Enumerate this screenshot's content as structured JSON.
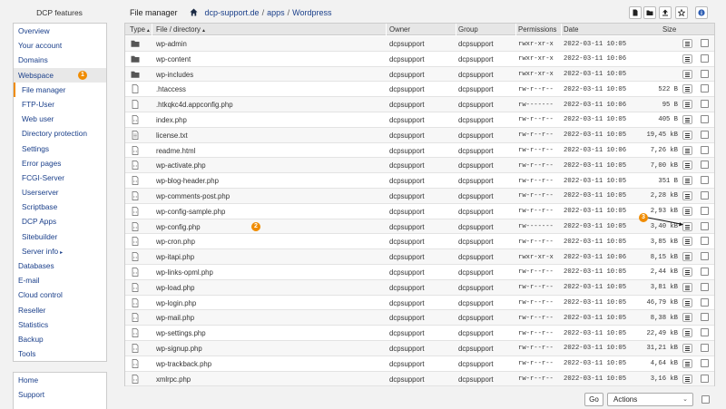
{
  "sidebar": {
    "title": "DCP features",
    "items": [
      {
        "label": "Overview",
        "level": 0
      },
      {
        "label": "Your account",
        "level": 0
      },
      {
        "label": "Domains",
        "level": 0
      },
      {
        "label": "Webspace",
        "level": 0,
        "active": true,
        "badge": "1"
      },
      {
        "label": "File manager",
        "level": 1,
        "current": true
      },
      {
        "label": "FTP-User",
        "level": 1
      },
      {
        "label": "Web user",
        "level": 1
      },
      {
        "label": "Directory protection",
        "level": 1
      },
      {
        "label": "Settings",
        "level": 1
      },
      {
        "label": "Error pages",
        "level": 1
      },
      {
        "label": "FCGI-Server",
        "level": 1
      },
      {
        "label": "Userserver",
        "level": 1
      },
      {
        "label": "Scriptbase",
        "level": 1
      },
      {
        "label": "DCP Apps",
        "level": 1
      },
      {
        "label": "Sitebuilder",
        "level": 1
      },
      {
        "label": "Server info",
        "level": 1,
        "arrow": "▸"
      },
      {
        "label": "Databases",
        "level": 0
      },
      {
        "label": "E-mail",
        "level": 0
      },
      {
        "label": "Cloud control",
        "level": 0
      },
      {
        "label": "Reseller",
        "level": 0
      },
      {
        "label": "Statistics",
        "level": 0
      },
      {
        "label": "Backup",
        "level": 0
      },
      {
        "label": "Tools",
        "level": 0
      }
    ],
    "bottom_items": [
      {
        "label": "Home"
      },
      {
        "label": "Support"
      }
    ]
  },
  "header": {
    "title": "File manager",
    "breadcrumb": [
      "dcp-support.de",
      "apps",
      "Wordpress"
    ],
    "breadcrumb_sep": "/",
    "tools": [
      "new-file-icon",
      "new-folder-icon",
      "upload-icon",
      "star-icon",
      "info-icon"
    ]
  },
  "table": {
    "columns": {
      "type": "Type",
      "name": "File / directory",
      "owner": "Owner",
      "group": "Group",
      "permissions": "Permissions",
      "date": "Date",
      "size": "Size"
    },
    "sort_arrow": "▲",
    "rows": [
      {
        "type": "folder",
        "name": "wp-admin",
        "owner": "dcpsupport",
        "group": "dcpsupport",
        "perm": "rwxr-xr-x",
        "date": "2022-03-11 10:05",
        "size": ""
      },
      {
        "type": "folder",
        "name": "wp-content",
        "owner": "dcpsupport",
        "group": "dcpsupport",
        "perm": "rwxr-xr-x",
        "date": "2022-03-11 10:06",
        "size": ""
      },
      {
        "type": "folder",
        "name": "wp-includes",
        "owner": "dcpsupport",
        "group": "dcpsupport",
        "perm": "rwxr-xr-x",
        "date": "2022-03-11 10:05",
        "size": ""
      },
      {
        "type": "file",
        "name": ".htaccess",
        "owner": "dcpsupport",
        "group": "dcpsupport",
        "perm": "rw-r--r--",
        "date": "2022-03-11 10:05",
        "size": "522 B"
      },
      {
        "type": "file",
        "name": ".htkqkc4d.appconfig.php",
        "owner": "dcpsupport",
        "group": "dcpsupport",
        "perm": "rw-------",
        "date": "2022-03-11 10:06",
        "size": "95 B"
      },
      {
        "type": "code",
        "name": "index.php",
        "owner": "dcpsupport",
        "group": "dcpsupport",
        "perm": "rw-r--r--",
        "date": "2022-03-11 10:05",
        "size": "405 B"
      },
      {
        "type": "text",
        "name": "license.txt",
        "owner": "dcpsupport",
        "group": "dcpsupport",
        "perm": "rw-r--r--",
        "date": "2022-03-11 10:05",
        "size": "19,45 kB"
      },
      {
        "type": "code",
        "name": "readme.html",
        "owner": "dcpsupport",
        "group": "dcpsupport",
        "perm": "rw-r--r--",
        "date": "2022-03-11 10:06",
        "size": "7,26 kB"
      },
      {
        "type": "code",
        "name": "wp-activate.php",
        "owner": "dcpsupport",
        "group": "dcpsupport",
        "perm": "rw-r--r--",
        "date": "2022-03-11 10:05",
        "size": "7,00 kB"
      },
      {
        "type": "code",
        "name": "wp-blog-header.php",
        "owner": "dcpsupport",
        "group": "dcpsupport",
        "perm": "rw-r--r--",
        "date": "2022-03-11 10:05",
        "size": "351 B"
      },
      {
        "type": "code",
        "name": "wp-comments-post.php",
        "owner": "dcpsupport",
        "group": "dcpsupport",
        "perm": "rw-r--r--",
        "date": "2022-03-11 10:05",
        "size": "2,28 kB"
      },
      {
        "type": "code",
        "name": "wp-config-sample.php",
        "owner": "dcpsupport",
        "group": "dcpsupport",
        "perm": "rw-r--r--",
        "date": "2022-03-11 10:05",
        "size": "2,93 kB"
      },
      {
        "type": "code",
        "name": "wp-config.php",
        "owner": "dcpsupport",
        "group": "dcpsupport",
        "perm": "rw-------",
        "date": "2022-03-11 10:05",
        "size": "3,40 kB",
        "badge": "2",
        "menu_badge": "3"
      },
      {
        "type": "code",
        "name": "wp-cron.php",
        "owner": "dcpsupport",
        "group": "dcpsupport",
        "perm": "rw-r--r--",
        "date": "2022-03-11 10:05",
        "size": "3,85 kB"
      },
      {
        "type": "code",
        "name": "wp-itapi.php",
        "owner": "dcpsupport",
        "group": "dcpsupport",
        "perm": "rwxr-xr-x",
        "date": "2022-03-11 10:06",
        "size": "8,15 kB"
      },
      {
        "type": "code",
        "name": "wp-links-opml.php",
        "owner": "dcpsupport",
        "group": "dcpsupport",
        "perm": "rw-r--r--",
        "date": "2022-03-11 10:05",
        "size": "2,44 kB"
      },
      {
        "type": "code",
        "name": "wp-load.php",
        "owner": "dcpsupport",
        "group": "dcpsupport",
        "perm": "rw-r--r--",
        "date": "2022-03-11 10:05",
        "size": "3,81 kB"
      },
      {
        "type": "code",
        "name": "wp-login.php",
        "owner": "dcpsupport",
        "group": "dcpsupport",
        "perm": "rw-r--r--",
        "date": "2022-03-11 10:05",
        "size": "46,79 kB"
      },
      {
        "type": "code",
        "name": "wp-mail.php",
        "owner": "dcpsupport",
        "group": "dcpsupport",
        "perm": "rw-r--r--",
        "date": "2022-03-11 10:05",
        "size": "8,38 kB"
      },
      {
        "type": "code",
        "name": "wp-settings.php",
        "owner": "dcpsupport",
        "group": "dcpsupport",
        "perm": "rw-r--r--",
        "date": "2022-03-11 10:05",
        "size": "22,49 kB"
      },
      {
        "type": "code",
        "name": "wp-signup.php",
        "owner": "dcpsupport",
        "group": "dcpsupport",
        "perm": "rw-r--r--",
        "date": "2022-03-11 10:05",
        "size": "31,21 kB"
      },
      {
        "type": "code",
        "name": "wp-trackback.php",
        "owner": "dcpsupport",
        "group": "dcpsupport",
        "perm": "rw-r--r--",
        "date": "2022-03-11 10:05",
        "size": "4,64 kB"
      },
      {
        "type": "code",
        "name": "xmlrpc.php",
        "owner": "dcpsupport",
        "group": "dcpsupport",
        "perm": "rw-r--r--",
        "date": "2022-03-11 10:05",
        "size": "3,16 kB"
      }
    ]
  },
  "footer": {
    "go_label": "Go",
    "actions_label": "Actions",
    "chevron": "⌄"
  },
  "colors": {
    "accent": "#f08c00",
    "link": "#1a3f8a"
  }
}
